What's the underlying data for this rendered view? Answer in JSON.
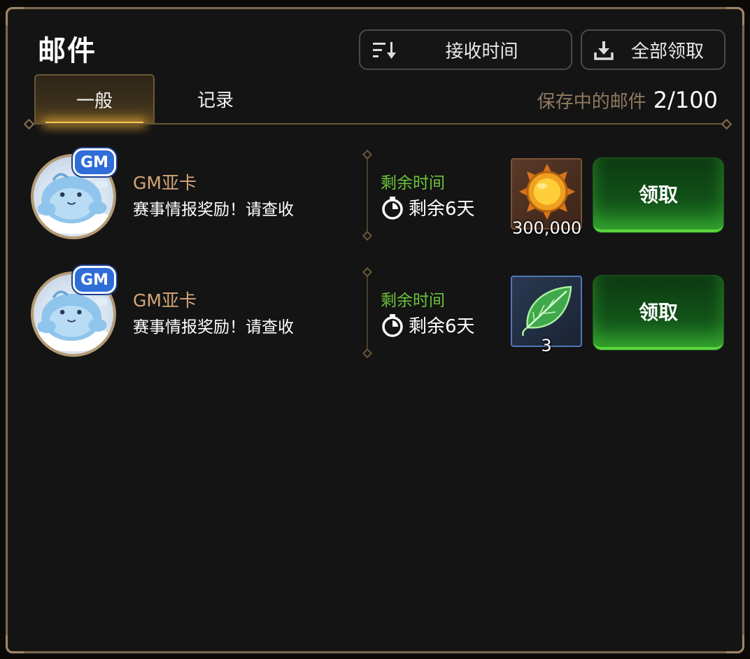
{
  "title": "邮件",
  "toolbar": {
    "sort_label": "接收时间",
    "claim_all_label": "全部领取"
  },
  "tabs": [
    {
      "label": "一般",
      "active": true
    },
    {
      "label": "记录",
      "active": false
    }
  ],
  "storage": {
    "label": "保存中的邮件",
    "value": "2/100"
  },
  "mails": [
    {
      "badge": "GM",
      "sender": "GM亚卡",
      "subject": "赛事情报奖励！请查收",
      "remain_label": "剩余时间",
      "remain_value": "剩余6天",
      "item_icon": "gold-coin-icon",
      "item_qty": "300,000",
      "claim_label": "领取"
    },
    {
      "badge": "GM",
      "sender": "GM亚卡",
      "subject": "赛事情报奖励！请查收",
      "remain_label": "剩余时间",
      "remain_value": "剩余6天",
      "item_icon": "green-leaf-icon",
      "item_qty": "3",
      "claim_label": "领取"
    }
  ],
  "colors": {
    "accent_gold": "#d4a678",
    "remain_green": "#6cc23a",
    "claim_green": "#1d7a22",
    "frame": "#7a6650"
  }
}
